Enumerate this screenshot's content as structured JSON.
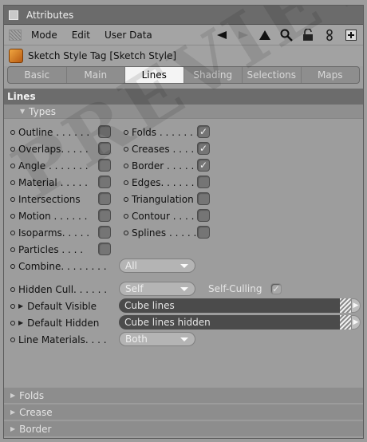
{
  "window": {
    "title": "Attributes"
  },
  "menu": {
    "items": [
      "Mode",
      "Edit",
      "User Data"
    ]
  },
  "object": {
    "title": "Sketch Style Tag [Sketch Style]"
  },
  "tabs": [
    "Basic",
    "Main",
    "Lines",
    "Shading",
    "Selections",
    "Maps"
  ],
  "active_tab": "Lines",
  "section": {
    "title": "Lines"
  },
  "types_group": {
    "label": "Types"
  },
  "left_items": [
    {
      "label": "Outline . . . . . .",
      "checked": false
    },
    {
      "label": "Overlaps. . . . .",
      "checked": false
    },
    {
      "label": "Angle . . . . . . .",
      "checked": false
    },
    {
      "label": "Material . . . . .",
      "checked": false
    },
    {
      "label": "Intersections",
      "checked": false
    },
    {
      "label": "Motion . . . . . .",
      "checked": false
    },
    {
      "label": "Isoparms. . . . .",
      "checked": false
    },
    {
      "label": "Particles . . . .",
      "checked": false
    }
  ],
  "right_items": [
    {
      "label": "Folds . . . . . . .",
      "checked": true
    },
    {
      "label": "Creases . . . . .",
      "checked": true
    },
    {
      "label": "Border . . . . . .",
      "checked": true
    },
    {
      "label": "Edges. . . . . . .",
      "checked": false
    },
    {
      "label": "Triangulation",
      "checked": false
    },
    {
      "label": "Contour . . . . .",
      "checked": false
    },
    {
      "label": "Splines . . . . . .",
      "checked": false
    }
  ],
  "combine": {
    "label": "Combine. . . . . . . .",
    "value": "All"
  },
  "hidden_cull": {
    "label": "Hidden Cull. . . . . .",
    "value": "Self",
    "self_culling_label": "Self-Culling",
    "self_culling_checked": true
  },
  "default_visible": {
    "label": "Default Visible",
    "value": "Cube lines"
  },
  "default_hidden": {
    "label": "Default Hidden",
    "value": "Cube lines hidden"
  },
  "line_materials": {
    "label": "Line Materials. . . .",
    "value": "Both"
  },
  "collapsed_groups": [
    "Folds",
    "Crease",
    "Border"
  ],
  "watermark": "PREVIEW"
}
